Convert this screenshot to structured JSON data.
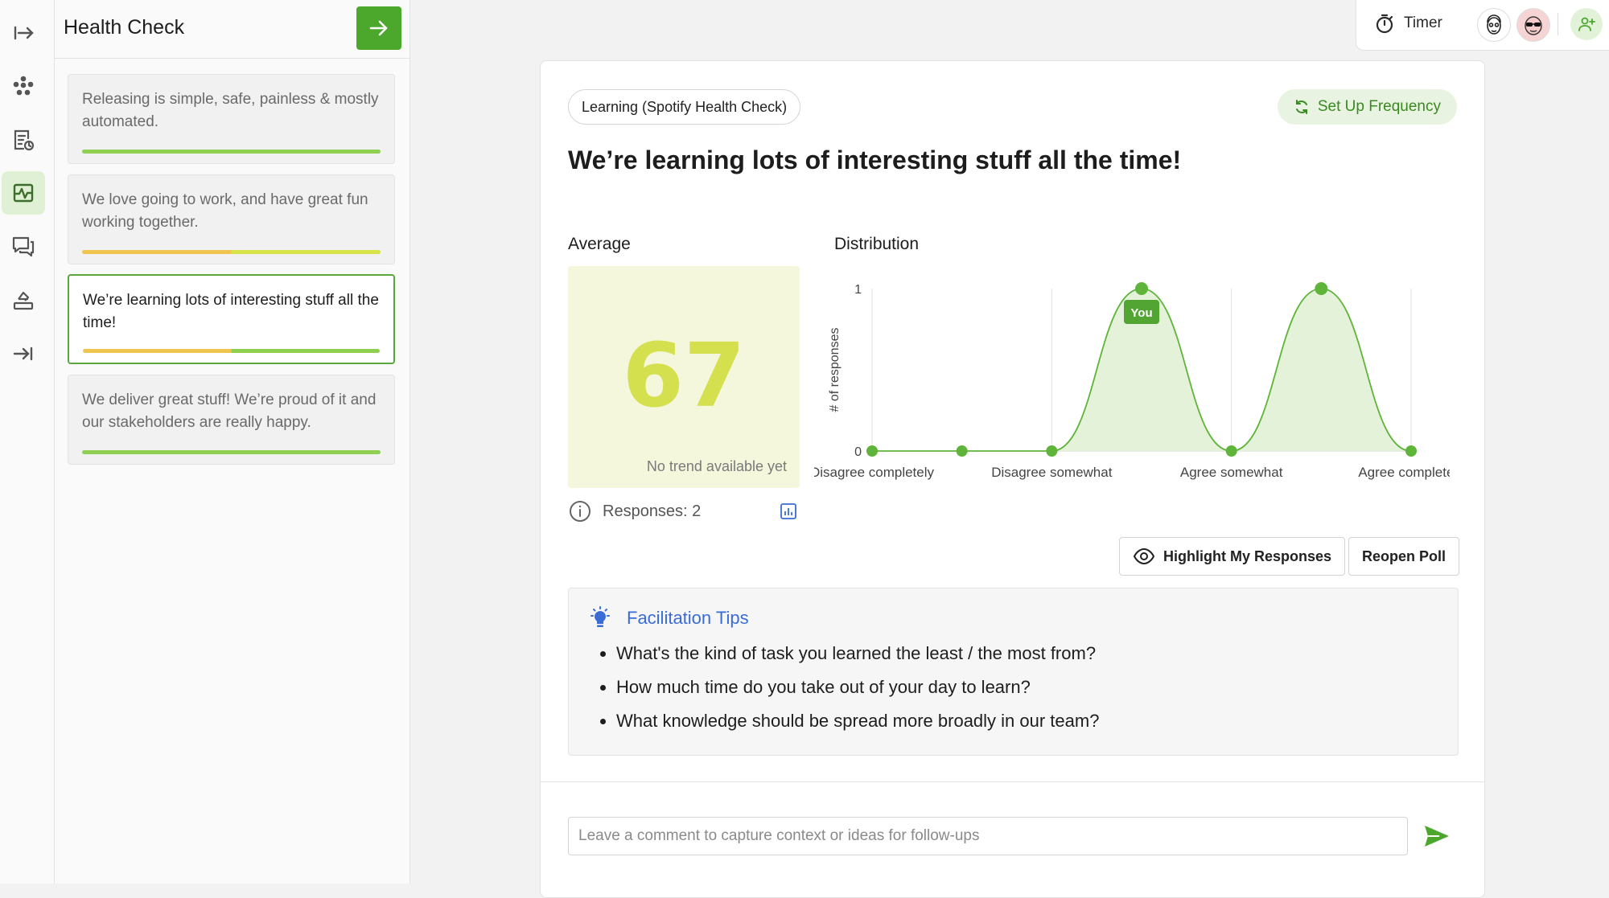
{
  "panel": {
    "title": "Health Check",
    "topics": [
      {
        "text": "Releasing is simple, safe, painless & mostly automated.",
        "bar_colors": [
          "#8fcf52",
          "#8fcf52"
        ],
        "bar_split_pct": 50
      },
      {
        "text": "We love going to work, and have great fun working together.",
        "bar_colors": [
          "#efc550",
          "#d8e34a"
        ],
        "bar_split_pct": 50
      },
      {
        "text": "We’re learning lots of interesting stuff all the time!",
        "bar_colors": [
          "#efc550",
          "#8fcf52"
        ],
        "bar_split_pct": 50
      },
      {
        "text": "We deliver great stuff! We’re proud of it and our stakeholders are really happy.",
        "bar_colors": [
          "#8fcf52",
          "#8fcf52"
        ],
        "bar_split_pct": 50
      }
    ],
    "active_index": 2
  },
  "topbar": {
    "timer_label": "Timer"
  },
  "card": {
    "chip": "Learning (Spotify Health Check)",
    "frequency_button": "Set Up Frequency",
    "question": "We’re learning lots of interesting stuff all the time!",
    "average_label": "Average",
    "average_value": "67",
    "trend_text": "No trend available yet",
    "responses_text": "Responses: 2",
    "distribution_label": "Distribution",
    "highlight_button": "Highlight My Responses",
    "reopen_button": "Reopen Poll",
    "tips_title": "Facilitation Tips",
    "tips": [
      "What's the kind of task you learned the least / the most from?",
      "How much time do you take out of your day to learn?",
      "What knowledge should be spread more broadly in our team?"
    ],
    "comment_placeholder": "Leave a comment to capture context or ideas for follow-ups"
  },
  "chart_data": {
    "type": "area",
    "ylabel": "# of responses",
    "ylim": [
      0,
      1
    ],
    "y_ticks": [
      "0",
      "1"
    ],
    "x": [
      0,
      1,
      2,
      3,
      4,
      5,
      6
    ],
    "x_tick_labels": [
      "Disagree completely",
      "Disagree somewhat",
      "Agree somewhat",
      "Agree completely"
    ],
    "x_tick_positions": [
      0,
      2,
      4,
      6
    ],
    "values": [
      0,
      0,
      0,
      1,
      0,
      1,
      0
    ],
    "you_marker_index": 3,
    "you_label": "You",
    "color": "#5fb43a",
    "fill": "#e3f2d8",
    "grid": "vertical"
  }
}
